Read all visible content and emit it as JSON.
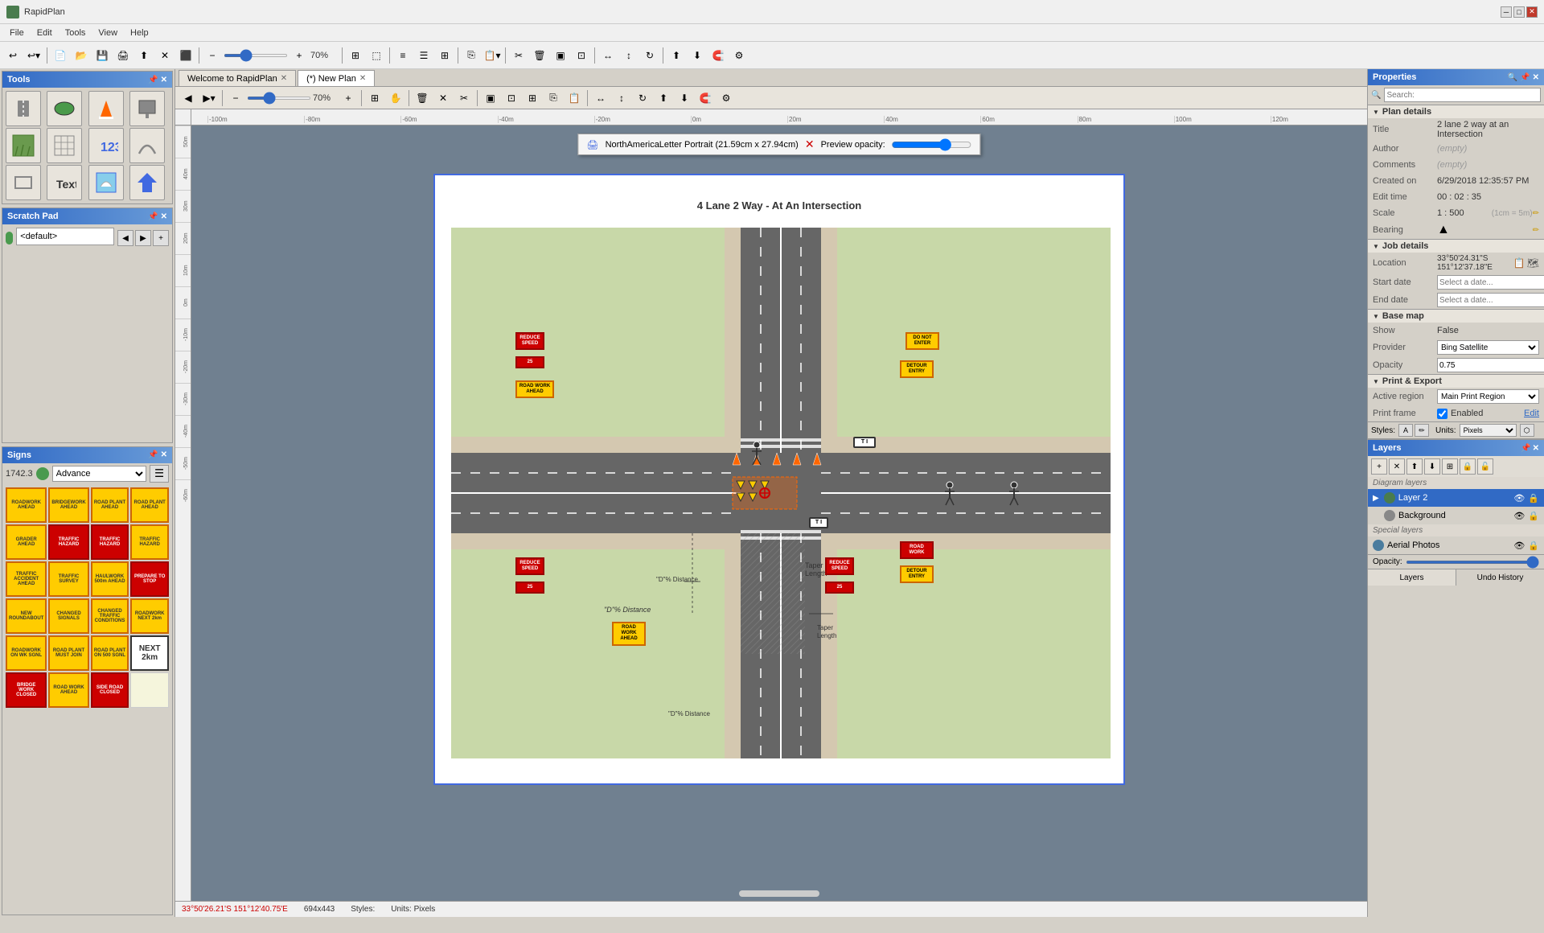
{
  "app": {
    "title": "RapidPlan",
    "window_controls": [
      "minimize",
      "maximize",
      "close"
    ]
  },
  "menu": {
    "items": [
      "File",
      "Edit",
      "Tools",
      "View",
      "Help"
    ]
  },
  "toolbar": {
    "zoom_label": "70%",
    "zoom_value": 70
  },
  "tabs": [
    {
      "label": "Welcome to RapidPlan",
      "active": false,
      "closable": true
    },
    {
      "label": "(*) New Plan",
      "active": true,
      "closable": true
    }
  ],
  "canvas": {
    "paper_title": "4 Lane 2 Way - At An Intersection",
    "paper_size": "NorthAmericaLetter Portrait (21.59cm x 27.94cm)",
    "preview_opacity_label": "Preview opacity:"
  },
  "tools_panel": {
    "title": "Tools",
    "items": [
      "road-tool",
      "oval-tool",
      "cone-tool",
      "panel-board-tool",
      "grass-tool",
      "grid-tool",
      "number-tool",
      "curve-tool",
      "rect-tool",
      "text-tool",
      "weather-tool",
      "arrow-tool"
    ]
  },
  "scratch_panel": {
    "title": "Scratch Pad",
    "default_label": "<default>"
  },
  "signs_panel": {
    "title": "Signs",
    "count": 1742.3,
    "category": "Advance",
    "signs": [
      {
        "label": "ROADWORK AHEAD",
        "type": "yellow"
      },
      {
        "label": "BRIDGEWORK AHEAD",
        "type": "yellow"
      },
      {
        "label": "ROAD PLANT AHEAD",
        "type": "yellow"
      },
      {
        "label": "ROAD PLANT AHEAD",
        "type": "yellow"
      },
      {
        "label": "GRADER AHEAD",
        "type": "yellow"
      },
      {
        "label": "TRAFFIC HAZARD",
        "type": "red"
      },
      {
        "label": "TRAFFIC HAZARD",
        "type": "red"
      },
      {
        "label": "TRAFFIC HAZARD",
        "type": "yellow"
      },
      {
        "label": "TRAFFIC ACCIDENT AHEAD",
        "type": "yellow"
      },
      {
        "label": "TRAFFIC SURVEY",
        "type": "yellow"
      },
      {
        "label": "HAULWORK 500m AHEAD",
        "type": "yellow"
      },
      {
        "label": "PREPARE TO STOP",
        "type": "red"
      },
      {
        "label": "NEW ROUNDABOUT",
        "type": "yellow"
      },
      {
        "label": "CHANGED SIGNALS",
        "type": "yellow"
      },
      {
        "label": "CHANGED TRAFFIC CONDITIONS",
        "type": "yellow"
      },
      {
        "label": "ROADWORK NEXT 2km",
        "type": "yellow"
      },
      {
        "label": "ROADWORK ON WK SGNL",
        "type": "yellow"
      },
      {
        "label": "ROAD PLANT MUST JOIN",
        "type": "yellow"
      },
      {
        "label": "ROAD PLANT ON 500 SGNL",
        "type": "yellow"
      },
      {
        "label": "NEXT 2km",
        "type": "white-bold"
      },
      {
        "label": "BRIDGE WORK CLOSED",
        "type": "red"
      },
      {
        "label": "ROAD WORK AHEAD",
        "type": "yellow"
      },
      {
        "label": "SIDE ROAD CLOSED",
        "type": "red"
      }
    ]
  },
  "properties": {
    "title": "Properties",
    "plan_details": {
      "section": "Plan details",
      "title_label": "Title",
      "title_value": "2 lane 2 way at an Intersection",
      "author_label": "Author",
      "author_value": "(empty)",
      "comments_label": "Comments",
      "comments_value": "(empty)",
      "created_on_label": "Created on",
      "created_on_value": "6/29/2018 12:35:57 PM",
      "edit_time_label": "Edit time",
      "edit_time_value": "00 : 02 : 35",
      "scale_label": "Scale",
      "scale_value": "1 : 500",
      "scale_detail": "(1cm = 5m)",
      "bearing_label": "Bearing"
    },
    "job_details": {
      "section": "Job details",
      "location_label": "Location",
      "location_line1": "33°50'24.31\"S",
      "location_line2": "151°12'37.18\"E",
      "start_date_label": "Start date",
      "start_date_placeholder": "Select a date...",
      "end_date_label": "End date",
      "end_date_placeholder": "Select a date..."
    },
    "base_map": {
      "section": "Base map",
      "show_label": "Show",
      "show_value": "False",
      "provider_label": "Provider",
      "provider_value": "Bing Satellite",
      "opacity_label": "Opacity",
      "opacity_value": "0.75"
    },
    "print_export": {
      "section": "Print & Export",
      "active_region_label": "Active region",
      "active_region_value": "Main Print Region",
      "print_frame_label": "Print frame",
      "print_frame_checked": true,
      "print_frame_value": "Enabled",
      "edit_label": "Edit"
    }
  },
  "layers": {
    "title": "Layers",
    "diagram_layers_label": "Diagram layers",
    "special_layers_label": "Special layers",
    "items": [
      {
        "name": "Layer 2",
        "active": true,
        "type": "diagram"
      },
      {
        "name": "Background",
        "active": false,
        "type": "diagram"
      },
      {
        "name": "Aerial Photos",
        "active": false,
        "type": "special"
      }
    ],
    "opacity_label": "Opacity:"
  },
  "status_bar": {
    "coords": "33°50'26.21'S 151°12'40.75'E",
    "dimensions": "694x443",
    "styles_label": "Styles:",
    "units_label": "Units: Pixels"
  },
  "ruler": {
    "marks": [
      "-100m",
      "-80m",
      "-60m",
      "-40m",
      "-20m",
      "0m",
      "20m",
      "40m",
      "60m",
      "80m",
      "100m",
      "120m"
    ]
  }
}
